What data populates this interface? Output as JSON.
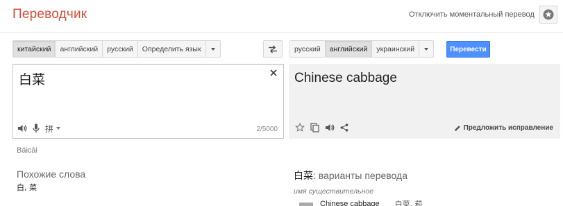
{
  "app": {
    "title": "Переводчик"
  },
  "header": {
    "instant_toggle_label": "Отключить моментальный перевод"
  },
  "source": {
    "languages": [
      "китайский",
      "английский",
      "русский",
      "Определить язык"
    ],
    "selected_index": 0,
    "text": "白菜",
    "char_count": "2/5000",
    "transliteration": "Báicài"
  },
  "target": {
    "languages": [
      "русский",
      "английский",
      "украинский"
    ],
    "selected_index": 1,
    "text": "Chinese cabbage",
    "translate_label": "Перевести",
    "suggest_label": "Предложить исправление"
  },
  "similar": {
    "title": "Похожие слова",
    "words": "白, 菜"
  },
  "dictionary": {
    "word": "白菜",
    "heading_suffix": ": варианты перевода",
    "part_of_speech": "имя существительное",
    "entries": [
      {
        "translation": "Chinese cabbage",
        "back_translations": "白菜, 菘",
        "frequency": 0.33
      }
    ]
  },
  "colors": {
    "title_red": "#dd4b39",
    "translate_blue": "#4d90fe",
    "target_bg": "#f1f1f1"
  },
  "icons": {
    "settings": "star-icon",
    "swap": "swap-icon",
    "clear": "close-icon",
    "listen": "speaker-icon",
    "mic": "microphone-icon",
    "input_tools": "pinyin-icon",
    "star": "star-outline-icon",
    "copy": "copy-icon",
    "share": "share-icon",
    "edit": "pencil-icon"
  }
}
